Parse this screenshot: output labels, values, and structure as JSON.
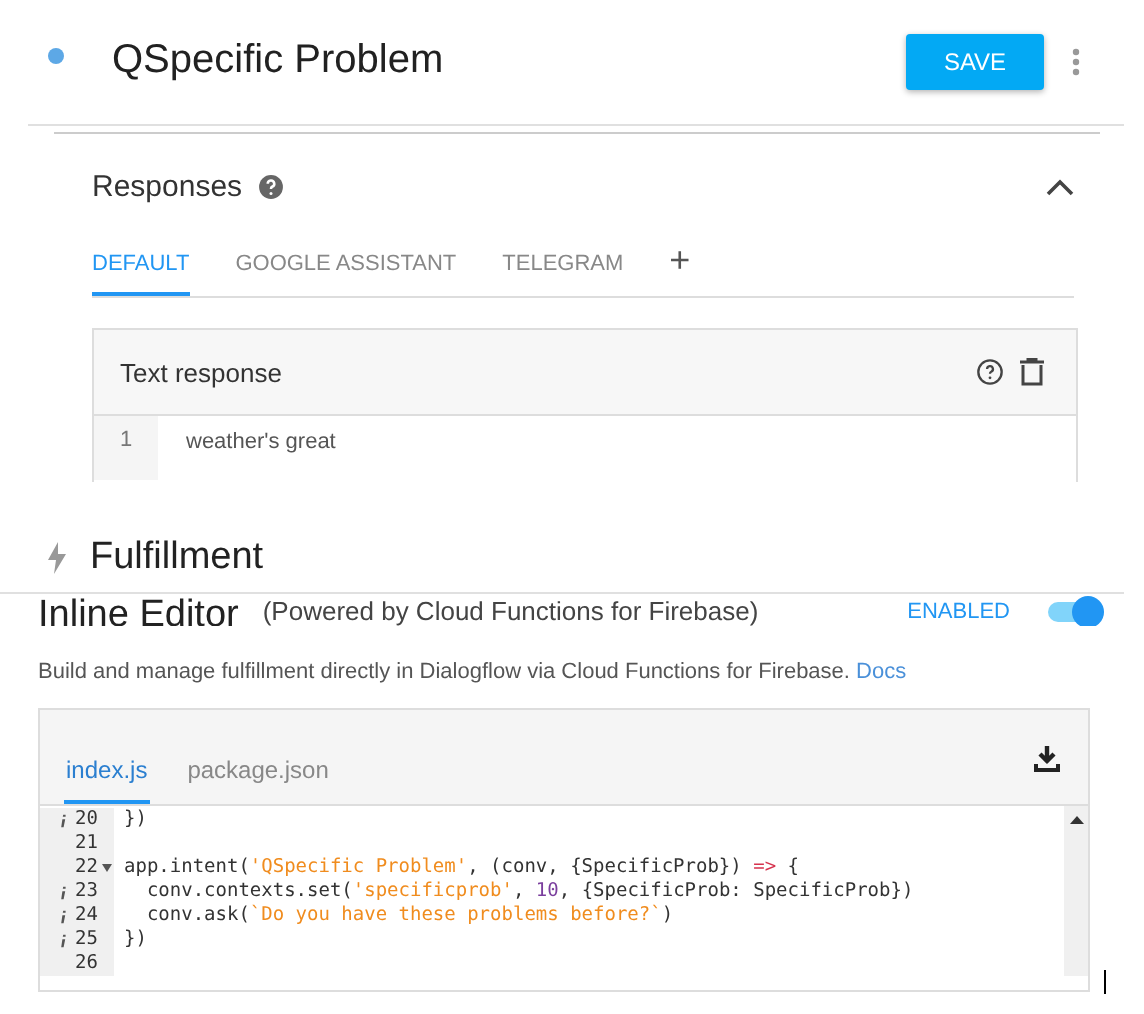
{
  "header": {
    "title": "QSpecific Problem",
    "save": "SAVE"
  },
  "responses": {
    "title": "Responses",
    "expanded": true,
    "tabs": [
      {
        "label": "DEFAULT",
        "selected": true
      },
      {
        "label": "GOOGLE ASSISTANT",
        "selected": false
      },
      {
        "label": "TELEGRAM",
        "selected": false
      }
    ],
    "add_tab": "+",
    "card": {
      "title": "Text response",
      "rows": [
        {
          "number": "1",
          "text": "weather's great"
        }
      ]
    }
  },
  "fulfillment": {
    "title": "Fulfillment",
    "inline_editor": {
      "title": "Inline Editor",
      "subtitle": "(Powered by Cloud Functions for Firebase)",
      "status": "ENABLED",
      "on": true,
      "description": "Build and manage fulfillment directly in Dialogflow via Cloud Functions for Firebase.",
      "docs_link": "Docs",
      "file_tabs": [
        {
          "label": "index.js",
          "selected": true
        },
        {
          "label": "package.json",
          "selected": false
        }
      ],
      "code_lines": [
        {
          "number": "20",
          "info": true,
          "fold": false,
          "tokens": [
            {
              "kind": "plain",
              "text": "})"
            }
          ]
        },
        {
          "number": "21",
          "info": false,
          "fold": false
        },
        {
          "number": "22",
          "info": false,
          "fold": true,
          "tokens": [
            {
              "kind": "plain",
              "text": "app.intent("
            },
            {
              "kind": "string",
              "text": "'QSpecific Problem'"
            },
            {
              "kind": "plain",
              "text": ", (conv, {SpecificProb}) "
            },
            {
              "kind": "operator",
              "text": "=>"
            },
            {
              "kind": "plain",
              "text": " {"
            }
          ]
        },
        {
          "number": "23",
          "info": true,
          "fold": false,
          "tokens": [
            {
              "kind": "plain",
              "text": "  conv.contexts.set("
            },
            {
              "kind": "string",
              "text": "'specificprob'"
            },
            {
              "kind": "plain",
              "text": ", "
            },
            {
              "kind": "number",
              "text": "10"
            },
            {
              "kind": "plain",
              "text": ", {SpecificProb: SpecificProb})"
            }
          ]
        },
        {
          "number": "24",
          "info": true,
          "fold": false,
          "tokens": [
            {
              "kind": "plain",
              "text": "  conv.ask("
            },
            {
              "kind": "string",
              "text": "`Do you have these problems before?`"
            },
            {
              "kind": "plain",
              "text": ")"
            }
          ]
        },
        {
          "number": "25",
          "info": true,
          "fold": false,
          "tokens": [
            {
              "kind": "plain",
              "text": "})"
            }
          ]
        },
        {
          "number": "26",
          "info": false,
          "fold": false
        }
      ]
    }
  }
}
